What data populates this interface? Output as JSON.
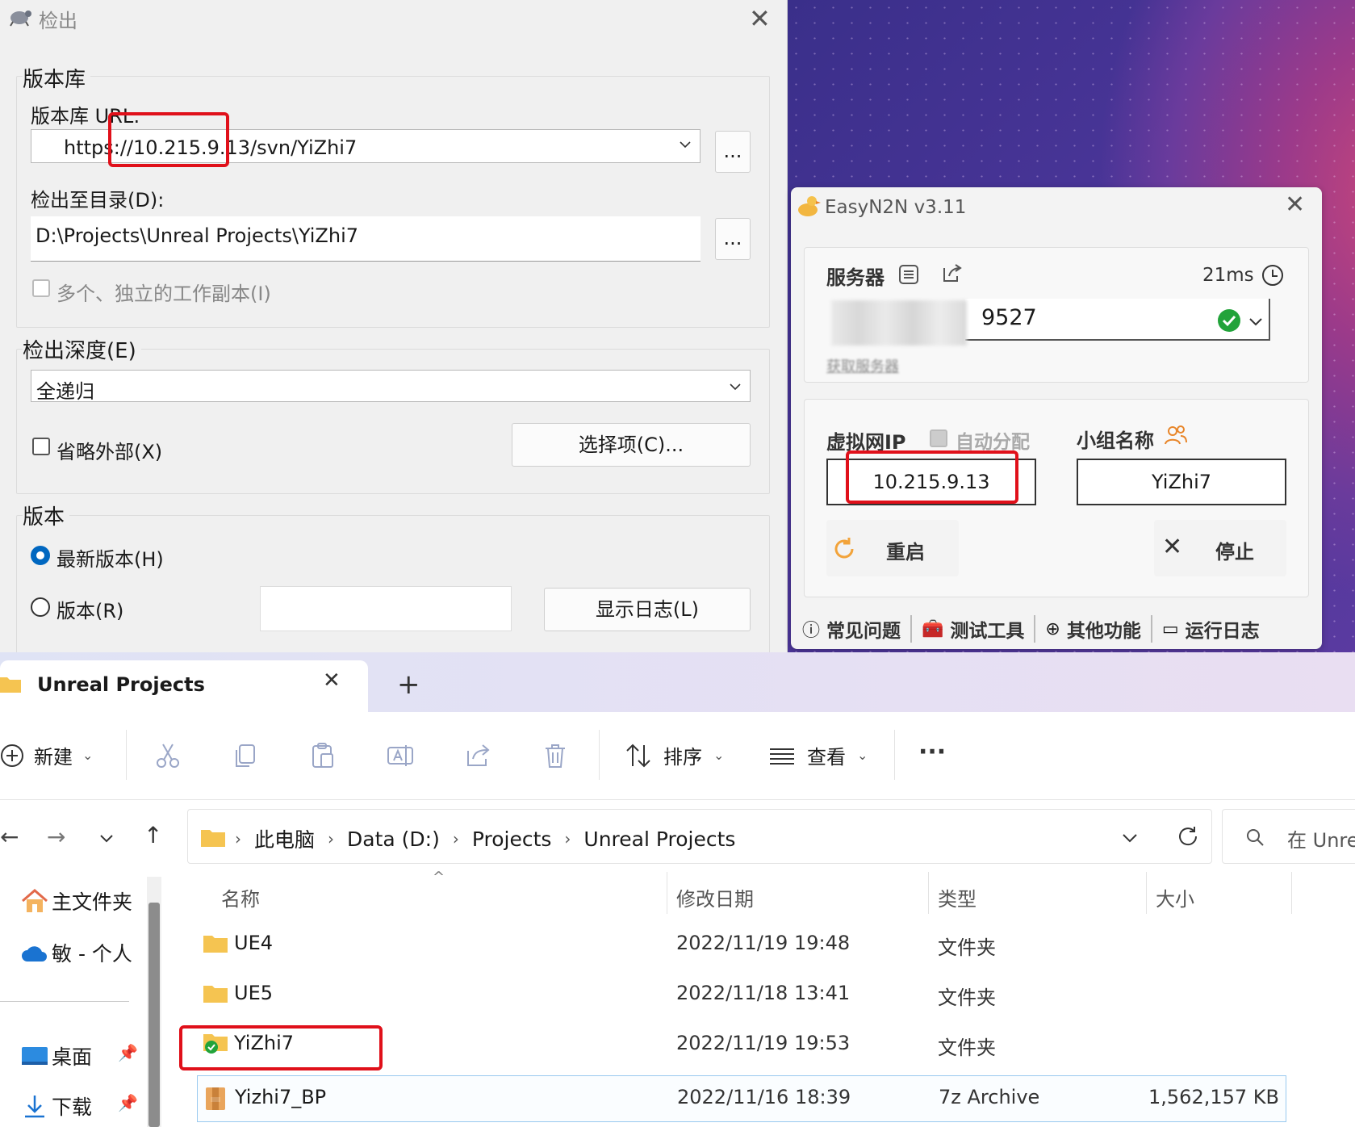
{
  "svn_dialog": {
    "title": "检出",
    "repo_group": "版本库",
    "repo_url_label": "版本库 URL:",
    "repo_url_value": "https://10.215.9.13/svn/YiZhi7",
    "browse_label": "...",
    "checkout_dir_label": "检出至目录(D):",
    "checkout_dir_value": "D:\\Projects\\Unreal Projects\\YiZhi7",
    "multi_wc_label": "多个、独立的工作副本(I)",
    "depth_group": "检出深度(E)",
    "depth_value": "全递归",
    "omit_externals_label": "省略外部(X)",
    "options_button": "选择项(C)...",
    "revision_group": "版本",
    "head_revision_label": "最新版本(H)",
    "revision_label": "版本(R)",
    "revision_value": "",
    "show_log_button": "显示日志(L)"
  },
  "n2n": {
    "title": "EasyN2N v3.11",
    "server_label": "服务器",
    "latency": "21ms",
    "server_value": "9527",
    "get_server_link": "获取服务器",
    "virtual_ip_label": "虚拟网IP",
    "auto_assign_label": "自动分配",
    "group_name_label": "小组名称",
    "virtual_ip_value": "10.215.9.13",
    "group_name_value": "YiZhi7",
    "restart_label": "重启",
    "stop_label": "停止",
    "footer": [
      "常见问题",
      "测试工具",
      "其他功能",
      "运行日志"
    ]
  },
  "explorer": {
    "tab_title": "Unreal Projects",
    "new_label": "新建",
    "sort_label": "排序",
    "view_label": "查看",
    "more_label": "···",
    "breadcrumbs": [
      "此电脑",
      "Data (D:)",
      "Projects",
      "Unreal Projects"
    ],
    "search_placeholder": "在 Unre",
    "nav": {
      "home": "主文件夹",
      "onedrive": "敏 - 个人",
      "desktop": "桌面",
      "downloads": "下载"
    },
    "columns": [
      "名称",
      "修改日期",
      "类型",
      "大小"
    ],
    "rows": [
      {
        "name": "UE4",
        "date": "2022/11/19 19:48",
        "type": "文件夹",
        "size": ""
      },
      {
        "name": "UE5",
        "date": "2022/11/18 13:41",
        "type": "文件夹",
        "size": ""
      },
      {
        "name": "YiZhi7",
        "date": "2022/11/19 19:53",
        "type": "文件夹",
        "size": ""
      },
      {
        "name": "Yizhi7_BP",
        "date": "2022/11/16 18:39",
        "type": "7z Archive",
        "size": "1,562,157 KB"
      }
    ]
  },
  "colors": {
    "highlight": "#e0101a",
    "accent": "#0067c0",
    "ok_green": "#22a33a"
  }
}
